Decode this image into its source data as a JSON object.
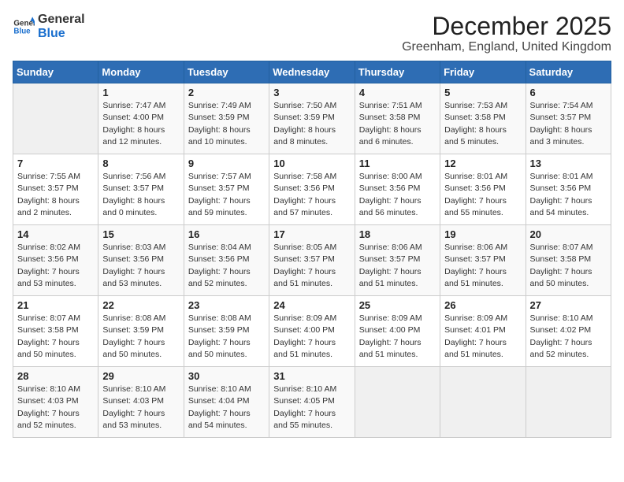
{
  "logo": {
    "general": "General",
    "blue": "Blue"
  },
  "title": "December 2025",
  "location": "Greenham, England, United Kingdom",
  "weekdays": [
    "Sunday",
    "Monday",
    "Tuesday",
    "Wednesday",
    "Thursday",
    "Friday",
    "Saturday"
  ],
  "weeks": [
    [
      {
        "day": "",
        "sunrise": "",
        "sunset": "",
        "daylight": ""
      },
      {
        "day": "1",
        "sunrise": "Sunrise: 7:47 AM",
        "sunset": "Sunset: 4:00 PM",
        "daylight": "Daylight: 8 hours and 12 minutes."
      },
      {
        "day": "2",
        "sunrise": "Sunrise: 7:49 AM",
        "sunset": "Sunset: 3:59 PM",
        "daylight": "Daylight: 8 hours and 10 minutes."
      },
      {
        "day": "3",
        "sunrise": "Sunrise: 7:50 AM",
        "sunset": "Sunset: 3:59 PM",
        "daylight": "Daylight: 8 hours and 8 minutes."
      },
      {
        "day": "4",
        "sunrise": "Sunrise: 7:51 AM",
        "sunset": "Sunset: 3:58 PM",
        "daylight": "Daylight: 8 hours and 6 minutes."
      },
      {
        "day": "5",
        "sunrise": "Sunrise: 7:53 AM",
        "sunset": "Sunset: 3:58 PM",
        "daylight": "Daylight: 8 hours and 5 minutes."
      },
      {
        "day": "6",
        "sunrise": "Sunrise: 7:54 AM",
        "sunset": "Sunset: 3:57 PM",
        "daylight": "Daylight: 8 hours and 3 minutes."
      }
    ],
    [
      {
        "day": "7",
        "sunrise": "Sunrise: 7:55 AM",
        "sunset": "Sunset: 3:57 PM",
        "daylight": "Daylight: 8 hours and 2 minutes."
      },
      {
        "day": "8",
        "sunrise": "Sunrise: 7:56 AM",
        "sunset": "Sunset: 3:57 PM",
        "daylight": "Daylight: 8 hours and 0 minutes."
      },
      {
        "day": "9",
        "sunrise": "Sunrise: 7:57 AM",
        "sunset": "Sunset: 3:57 PM",
        "daylight": "Daylight: 7 hours and 59 minutes."
      },
      {
        "day": "10",
        "sunrise": "Sunrise: 7:58 AM",
        "sunset": "Sunset: 3:56 PM",
        "daylight": "Daylight: 7 hours and 57 minutes."
      },
      {
        "day": "11",
        "sunrise": "Sunrise: 8:00 AM",
        "sunset": "Sunset: 3:56 PM",
        "daylight": "Daylight: 7 hours and 56 minutes."
      },
      {
        "day": "12",
        "sunrise": "Sunrise: 8:01 AM",
        "sunset": "Sunset: 3:56 PM",
        "daylight": "Daylight: 7 hours and 55 minutes."
      },
      {
        "day": "13",
        "sunrise": "Sunrise: 8:01 AM",
        "sunset": "Sunset: 3:56 PM",
        "daylight": "Daylight: 7 hours and 54 minutes."
      }
    ],
    [
      {
        "day": "14",
        "sunrise": "Sunrise: 8:02 AM",
        "sunset": "Sunset: 3:56 PM",
        "daylight": "Daylight: 7 hours and 53 minutes."
      },
      {
        "day": "15",
        "sunrise": "Sunrise: 8:03 AM",
        "sunset": "Sunset: 3:56 PM",
        "daylight": "Daylight: 7 hours and 53 minutes."
      },
      {
        "day": "16",
        "sunrise": "Sunrise: 8:04 AM",
        "sunset": "Sunset: 3:56 PM",
        "daylight": "Daylight: 7 hours and 52 minutes."
      },
      {
        "day": "17",
        "sunrise": "Sunrise: 8:05 AM",
        "sunset": "Sunset: 3:57 PM",
        "daylight": "Daylight: 7 hours and 51 minutes."
      },
      {
        "day": "18",
        "sunrise": "Sunrise: 8:06 AM",
        "sunset": "Sunset: 3:57 PM",
        "daylight": "Daylight: 7 hours and 51 minutes."
      },
      {
        "day": "19",
        "sunrise": "Sunrise: 8:06 AM",
        "sunset": "Sunset: 3:57 PM",
        "daylight": "Daylight: 7 hours and 51 minutes."
      },
      {
        "day": "20",
        "sunrise": "Sunrise: 8:07 AM",
        "sunset": "Sunset: 3:58 PM",
        "daylight": "Daylight: 7 hours and 50 minutes."
      }
    ],
    [
      {
        "day": "21",
        "sunrise": "Sunrise: 8:07 AM",
        "sunset": "Sunset: 3:58 PM",
        "daylight": "Daylight: 7 hours and 50 minutes."
      },
      {
        "day": "22",
        "sunrise": "Sunrise: 8:08 AM",
        "sunset": "Sunset: 3:59 PM",
        "daylight": "Daylight: 7 hours and 50 minutes."
      },
      {
        "day": "23",
        "sunrise": "Sunrise: 8:08 AM",
        "sunset": "Sunset: 3:59 PM",
        "daylight": "Daylight: 7 hours and 50 minutes."
      },
      {
        "day": "24",
        "sunrise": "Sunrise: 8:09 AM",
        "sunset": "Sunset: 4:00 PM",
        "daylight": "Daylight: 7 hours and 51 minutes."
      },
      {
        "day": "25",
        "sunrise": "Sunrise: 8:09 AM",
        "sunset": "Sunset: 4:00 PM",
        "daylight": "Daylight: 7 hours and 51 minutes."
      },
      {
        "day": "26",
        "sunrise": "Sunrise: 8:09 AM",
        "sunset": "Sunset: 4:01 PM",
        "daylight": "Daylight: 7 hours and 51 minutes."
      },
      {
        "day": "27",
        "sunrise": "Sunrise: 8:10 AM",
        "sunset": "Sunset: 4:02 PM",
        "daylight": "Daylight: 7 hours and 52 minutes."
      }
    ],
    [
      {
        "day": "28",
        "sunrise": "Sunrise: 8:10 AM",
        "sunset": "Sunset: 4:03 PM",
        "daylight": "Daylight: 7 hours and 52 minutes."
      },
      {
        "day": "29",
        "sunrise": "Sunrise: 8:10 AM",
        "sunset": "Sunset: 4:03 PM",
        "daylight": "Daylight: 7 hours and 53 minutes."
      },
      {
        "day": "30",
        "sunrise": "Sunrise: 8:10 AM",
        "sunset": "Sunset: 4:04 PM",
        "daylight": "Daylight: 7 hours and 54 minutes."
      },
      {
        "day": "31",
        "sunrise": "Sunrise: 8:10 AM",
        "sunset": "Sunset: 4:05 PM",
        "daylight": "Daylight: 7 hours and 55 minutes."
      },
      {
        "day": "",
        "sunrise": "",
        "sunset": "",
        "daylight": ""
      },
      {
        "day": "",
        "sunrise": "",
        "sunset": "",
        "daylight": ""
      },
      {
        "day": "",
        "sunrise": "",
        "sunset": "",
        "daylight": ""
      }
    ]
  ]
}
